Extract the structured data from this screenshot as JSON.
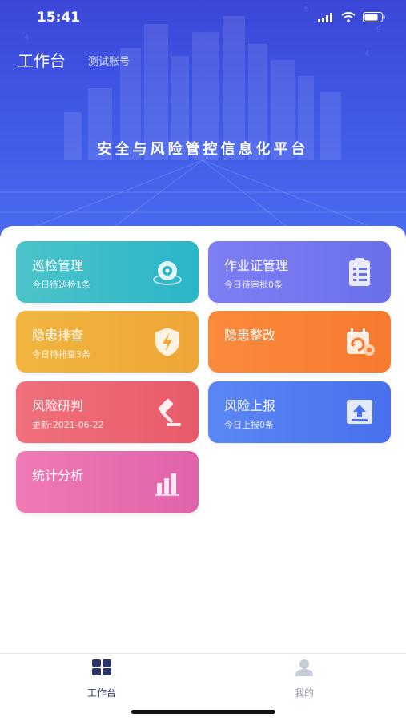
{
  "status": {
    "time": "15:41"
  },
  "header": {
    "title": "工作台",
    "account": "测试账号"
  },
  "hero": {
    "slogan": "安全与风险管控信息化平台"
  },
  "cards": [
    {
      "title": "巡检管理",
      "subtitle": "今日待巡检1条",
      "icon": "inspection-icon"
    },
    {
      "title": "作业证管理",
      "subtitle": "今日待审批0条",
      "icon": "clipboard-icon"
    },
    {
      "title": "隐患排查",
      "subtitle": "今日待排查3条",
      "icon": "shield-bolt-icon"
    },
    {
      "title": "隐患整改",
      "subtitle": "",
      "icon": "calendar-refresh-icon"
    },
    {
      "title": "风险研判",
      "subtitle": "更新:2021-06-22",
      "icon": "gavel-icon"
    },
    {
      "title": "风险上报",
      "subtitle": "今日上报0条",
      "icon": "upload-icon"
    },
    {
      "title": "统计分析",
      "subtitle": "",
      "icon": "bar-chart-icon"
    }
  ],
  "tabbar": {
    "items": [
      {
        "label": "工作台",
        "icon": "grid-icon",
        "active": true
      },
      {
        "label": "我的",
        "icon": "user-icon",
        "active": false
      }
    ],
    "active_color": "#2c3566",
    "inactive_color": "#9aa0ad"
  },
  "colors": {
    "hero": "#3f58e6",
    "card_inspection": "#2ab5c8",
    "card_permit": "#6a70ea",
    "card_hazard_check": "#eea636",
    "card_rectify": "#f77a2e",
    "card_risk_judge": "#e85a6a",
    "card_risk_report": "#4a70ee",
    "card_statistics": "#e062a8"
  }
}
